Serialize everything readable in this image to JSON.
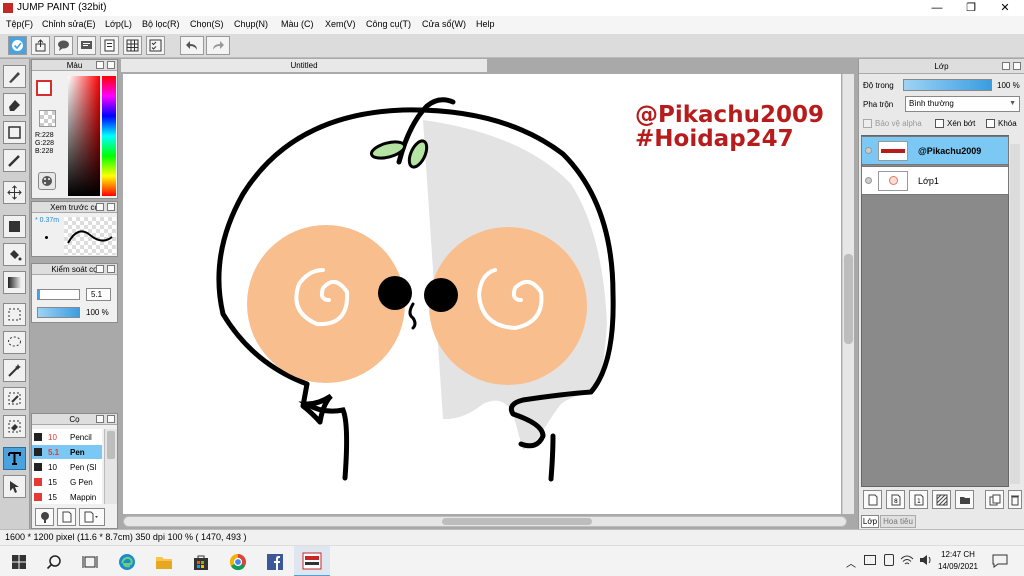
{
  "window": {
    "title": "JUMP PAINT (32bit)",
    "minimize": "—",
    "restore": "❐",
    "close": "✕"
  },
  "menu": [
    "Tệp(F)",
    "Chỉnh sửa(E)",
    "Lớp(L)",
    "Bộ lọc(R)",
    "Chọn(S)",
    "Chụp(N)",
    "Màu (C)",
    "Xem(V)",
    "Công cụ(T)",
    "Cửa sổ(W)",
    "Help"
  ],
  "panels": {
    "color": {
      "title": "Màu",
      "r": "R:228",
      "g": "G:228",
      "b": "B:228"
    },
    "brush_preview": {
      "title": "Xem trước cọ",
      "size": "0.37m"
    },
    "brush_control": {
      "title": "Kiểm soát cọ",
      "size_value": "5.1",
      "opacity_value": "100 %"
    },
    "brushes": {
      "title": "Cọ",
      "items": [
        {
          "size": "10",
          "name": "Pencil",
          "color": "#222222"
        },
        {
          "size": "5.1",
          "name": "Pen",
          "color": "#222222"
        },
        {
          "size": "10",
          "name": "Pen (Sl",
          "color": "#222222"
        },
        {
          "size": "15",
          "name": "G Pen",
          "color": "#e53935"
        },
        {
          "size": "15",
          "name": "Mappin",
          "color": "#e53935"
        }
      ]
    }
  },
  "document": {
    "tab": "Untitled",
    "watermark_1": "@Pikachu2009",
    "watermark_2": "#Hoidap247"
  },
  "layers_panel": {
    "title": "Lớp",
    "opacity_label": "Độ trong",
    "opacity_value": "100 %",
    "blend_label": "Pha trộn",
    "blend_value": "Bình thường",
    "protect_alpha": "Bảo vệ alpha",
    "clipping": "Xén bớt",
    "lock": "Khóa",
    "layers": [
      {
        "name": "@Pikachu2009",
        "selected": true
      },
      {
        "name": "Lớp1",
        "selected": false
      }
    ],
    "tab_layer": "Lớp",
    "tab_pattern": "Hoa tiêu"
  },
  "status": {
    "canvas_info": "1600 * 1200 pixel  (11.6 * 8.7cm)  350 dpi  100 %  ( 1470, 493 )"
  },
  "taskbar": {
    "time": "12:47 CH",
    "date": "14/09/2021"
  },
  "colors": {
    "accent": "#4aa3df",
    "watermark": "#b71c1c",
    "cheek": "#f9be8e",
    "selected_layer": "#7cc8f4"
  }
}
